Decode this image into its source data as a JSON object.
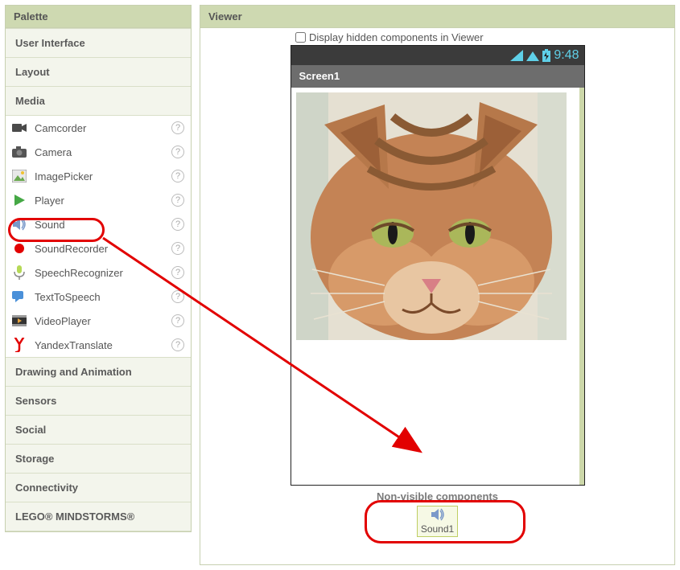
{
  "palette": {
    "title": "Palette",
    "categories": {
      "ui": "User Interface",
      "layout": "Layout",
      "media": "Media",
      "drawing": "Drawing and Animation",
      "sensors": "Sensors",
      "social": "Social",
      "storage": "Storage",
      "connectivity": "Connectivity",
      "lego": "LEGO® MINDSTORMS®"
    },
    "media_items": [
      {
        "name": "Camcorder"
      },
      {
        "name": "Camera"
      },
      {
        "name": "ImagePicker"
      },
      {
        "name": "Player"
      },
      {
        "name": "Sound"
      },
      {
        "name": "SoundRecorder"
      },
      {
        "name": "SpeechRecognizer"
      },
      {
        "name": "TextToSpeech"
      },
      {
        "name": "VideoPlayer"
      },
      {
        "name": "YandexTranslate"
      }
    ]
  },
  "viewer": {
    "title": "Viewer",
    "hidden_toggle_label": "Display hidden components in Viewer",
    "hidden_toggle_checked": false,
    "status_time": "9:48",
    "screen_title": "Screen1",
    "nonvisible_label": "Non-visible components",
    "nonvisible_component": "Sound1"
  },
  "help_glyph": "?"
}
